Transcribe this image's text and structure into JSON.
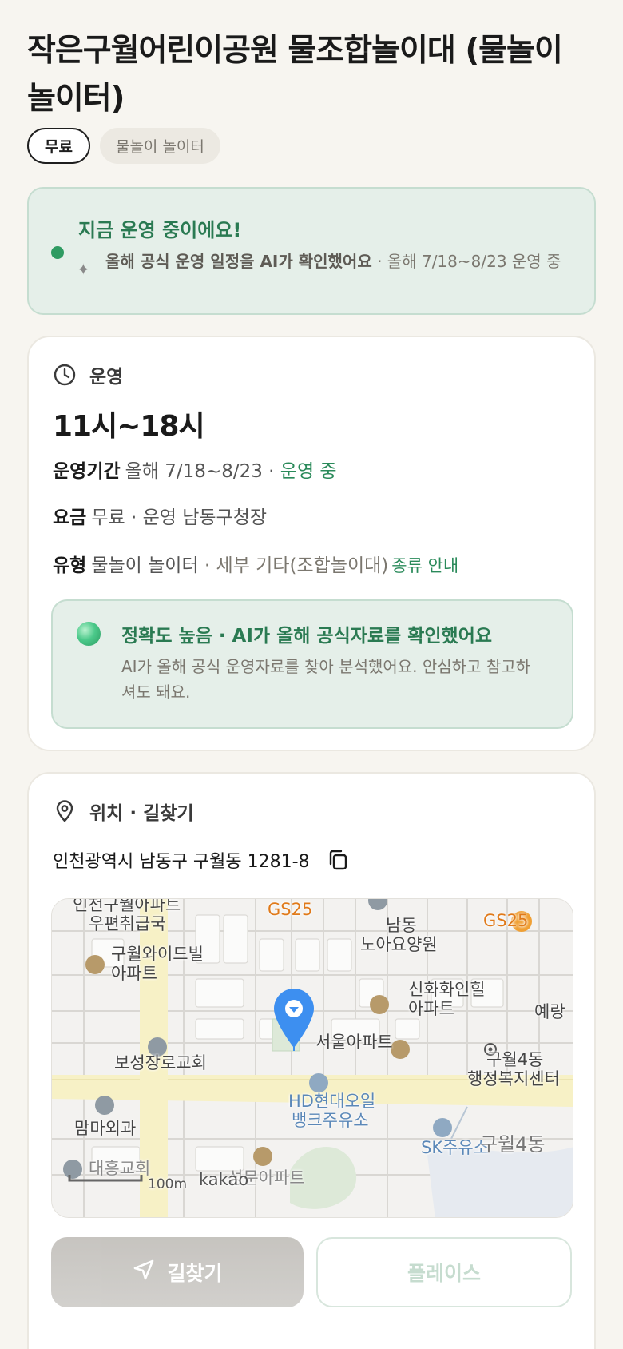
{
  "place": {
    "title": "작은구월어린이공원 물조합놀이대 (물놀이 놀이터)",
    "tags": [
      "무료",
      "물놀이 놀이터"
    ]
  },
  "status": {
    "headline": "지금 운영 중이에요!",
    "detail_bold": "올해 공식 운영 일정을 AI가 확인했어요",
    "detail_rest": " · 올해 7/18~8/23 운영 중"
  },
  "operation": {
    "section_title": "운영",
    "hours": "11시~18시",
    "period_label": "운영기간",
    "period_value": "올해 7/18~8/23 · ",
    "period_status": "운영 중",
    "fee_label": "요금",
    "fee_value": "무료 · 운영 남동구청장",
    "type_label": "유형",
    "type_value": "물놀이 놀이터",
    "type_detail": " · 세부 기타(조합놀이대)",
    "type_link": "종류 안내",
    "accuracy_title": "정확도 높음 · AI가 올해 공식자료를 확인했어요",
    "accuracy_body": "AI가 올해 공식 운영자료를 찾아 분석했어요. 안심하고 참고하셔도 돼요."
  },
  "location": {
    "section_title": "위치 · 길찾기",
    "address": "인천광역시 남동구 구월동 1281-8",
    "map": {
      "labels": {
        "top_left_1": "인천구월아파트",
        "top_left_2": "우편취급국",
        "gs25_a": "GS25",
        "gs25_b": "GS25",
        "nursing_1": "남동",
        "nursing_2": "노아요양원",
        "widebil_1": "구월와이드빌",
        "widebil_2": "아파트",
        "shinhwa_1": "신화화인힐",
        "shinhwa_2": "아파트",
        "yerang": "예랑",
        "seoul_apt": "서울아파트",
        "community_1": "구월4동",
        "community_2": "행정복지센터",
        "church": "보성장로교회",
        "hd_oil_1": "HD현대오일",
        "hd_oil_2": "뱅크주유소",
        "mamma": "맘마외과",
        "sk_oil": "SK주유소",
        "area": "구월4동",
        "daeheung": "대흥교회",
        "apt_bottom": "성문아파트",
        "scale": "100m",
        "brand": "kakao"
      }
    }
  },
  "actions": {
    "route": "길찾기",
    "place": "플레이스"
  },
  "colors": {
    "accent_green": "#2a7a52",
    "status_bg": "#e5efe9",
    "pin_blue": "#3d8ff0"
  }
}
